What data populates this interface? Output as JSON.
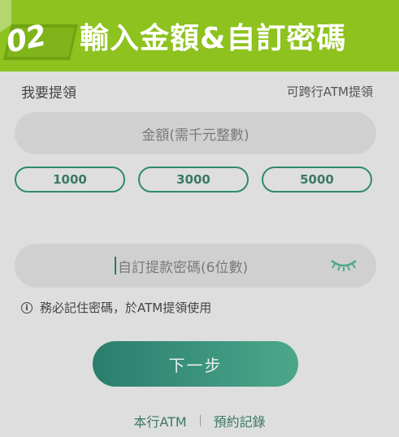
{
  "banner": {
    "step": "02",
    "title": "輸入金額&自訂密碼"
  },
  "form": {
    "withdraw_label": "我要提領",
    "atm_note": "可跨行ATM提領",
    "amount_placeholder": "金額(需千元整數)",
    "quick_amounts": [
      "1000",
      "3000",
      "5000"
    ],
    "password_placeholder": "自訂提款密碼(6位數)",
    "hint": "務必記住密碼，於ATM提領使用",
    "next_button": "下一步"
  },
  "footer": {
    "link_atm": "本行ATM",
    "link_records": "預約記錄"
  },
  "colors": {
    "banner": "#8dc21f",
    "accent": "#2e8a6c",
    "button_gradient_start": "#2a7d6d",
    "button_gradient_end": "#4ba78a"
  },
  "icons": {
    "info": "info-icon",
    "password_toggle": "eye-closed-icon"
  }
}
